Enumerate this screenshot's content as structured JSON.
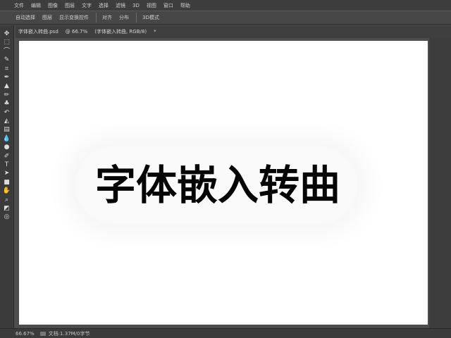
{
  "menu": [
    {
      "label": "文件"
    },
    {
      "label": "编辑"
    },
    {
      "label": "图像"
    },
    {
      "label": "图层"
    },
    {
      "label": "文字"
    },
    {
      "label": "选择"
    },
    {
      "label": "滤镜"
    },
    {
      "label": "3D"
    },
    {
      "label": "视图"
    },
    {
      "label": "窗口"
    },
    {
      "label": "帮助"
    }
  ],
  "options": [
    {
      "label": "自动选择"
    },
    {
      "label": "图层"
    },
    {
      "label": "显示变换控件"
    },
    {
      "label": "对齐"
    },
    {
      "label": "分布"
    },
    {
      "label": "3D模式"
    }
  ],
  "tabs": [
    {
      "label": "字体嵌入转曲.psd"
    },
    {
      "label": "@ 66.7%"
    },
    {
      "label": "(字体嵌入转曲, RGB/8)"
    },
    {
      "label": "*"
    }
  ],
  "tools": [
    {
      "name": "move-tool-icon",
      "glyph": "✥"
    },
    {
      "name": "marquee-tool-icon",
      "glyph": "⬚"
    },
    {
      "name": "lasso-tool-icon",
      "glyph": "⌒"
    },
    {
      "name": "quick-select-tool-icon",
      "glyph": "✎"
    },
    {
      "name": "crop-tool-icon",
      "glyph": "⌗"
    },
    {
      "name": "eyedropper-tool-icon",
      "glyph": "✒"
    },
    {
      "name": "healing-brush-tool-icon",
      "glyph": "▲"
    },
    {
      "name": "brush-tool-icon",
      "glyph": "✏"
    },
    {
      "name": "clone-stamp-tool-icon",
      "glyph": "♣"
    },
    {
      "name": "history-brush-tool-icon",
      "glyph": "↶"
    },
    {
      "name": "eraser-tool-icon",
      "glyph": "◭"
    },
    {
      "name": "gradient-tool-icon",
      "glyph": "▤"
    },
    {
      "name": "blur-tool-icon",
      "glyph": "💧"
    },
    {
      "name": "dodge-tool-icon",
      "glyph": "●"
    },
    {
      "name": "pen-tool-icon",
      "glyph": "✐"
    },
    {
      "name": "type-tool-icon",
      "glyph": "T"
    },
    {
      "name": "path-select-tool-icon",
      "glyph": "➤"
    },
    {
      "name": "shape-tool-icon",
      "glyph": "■"
    },
    {
      "name": "hand-tool-icon",
      "glyph": "✋"
    },
    {
      "name": "zoom-tool-icon",
      "glyph": "⌕"
    },
    {
      "name": "color-swatch-icon",
      "glyph": "◩"
    },
    {
      "name": "quick-mask-icon",
      "glyph": "◎"
    }
  ],
  "canvas": {
    "headline": "字体嵌入转曲"
  },
  "status": {
    "zoom": "66.67%",
    "doc": "文档:1.37M/0字节"
  }
}
